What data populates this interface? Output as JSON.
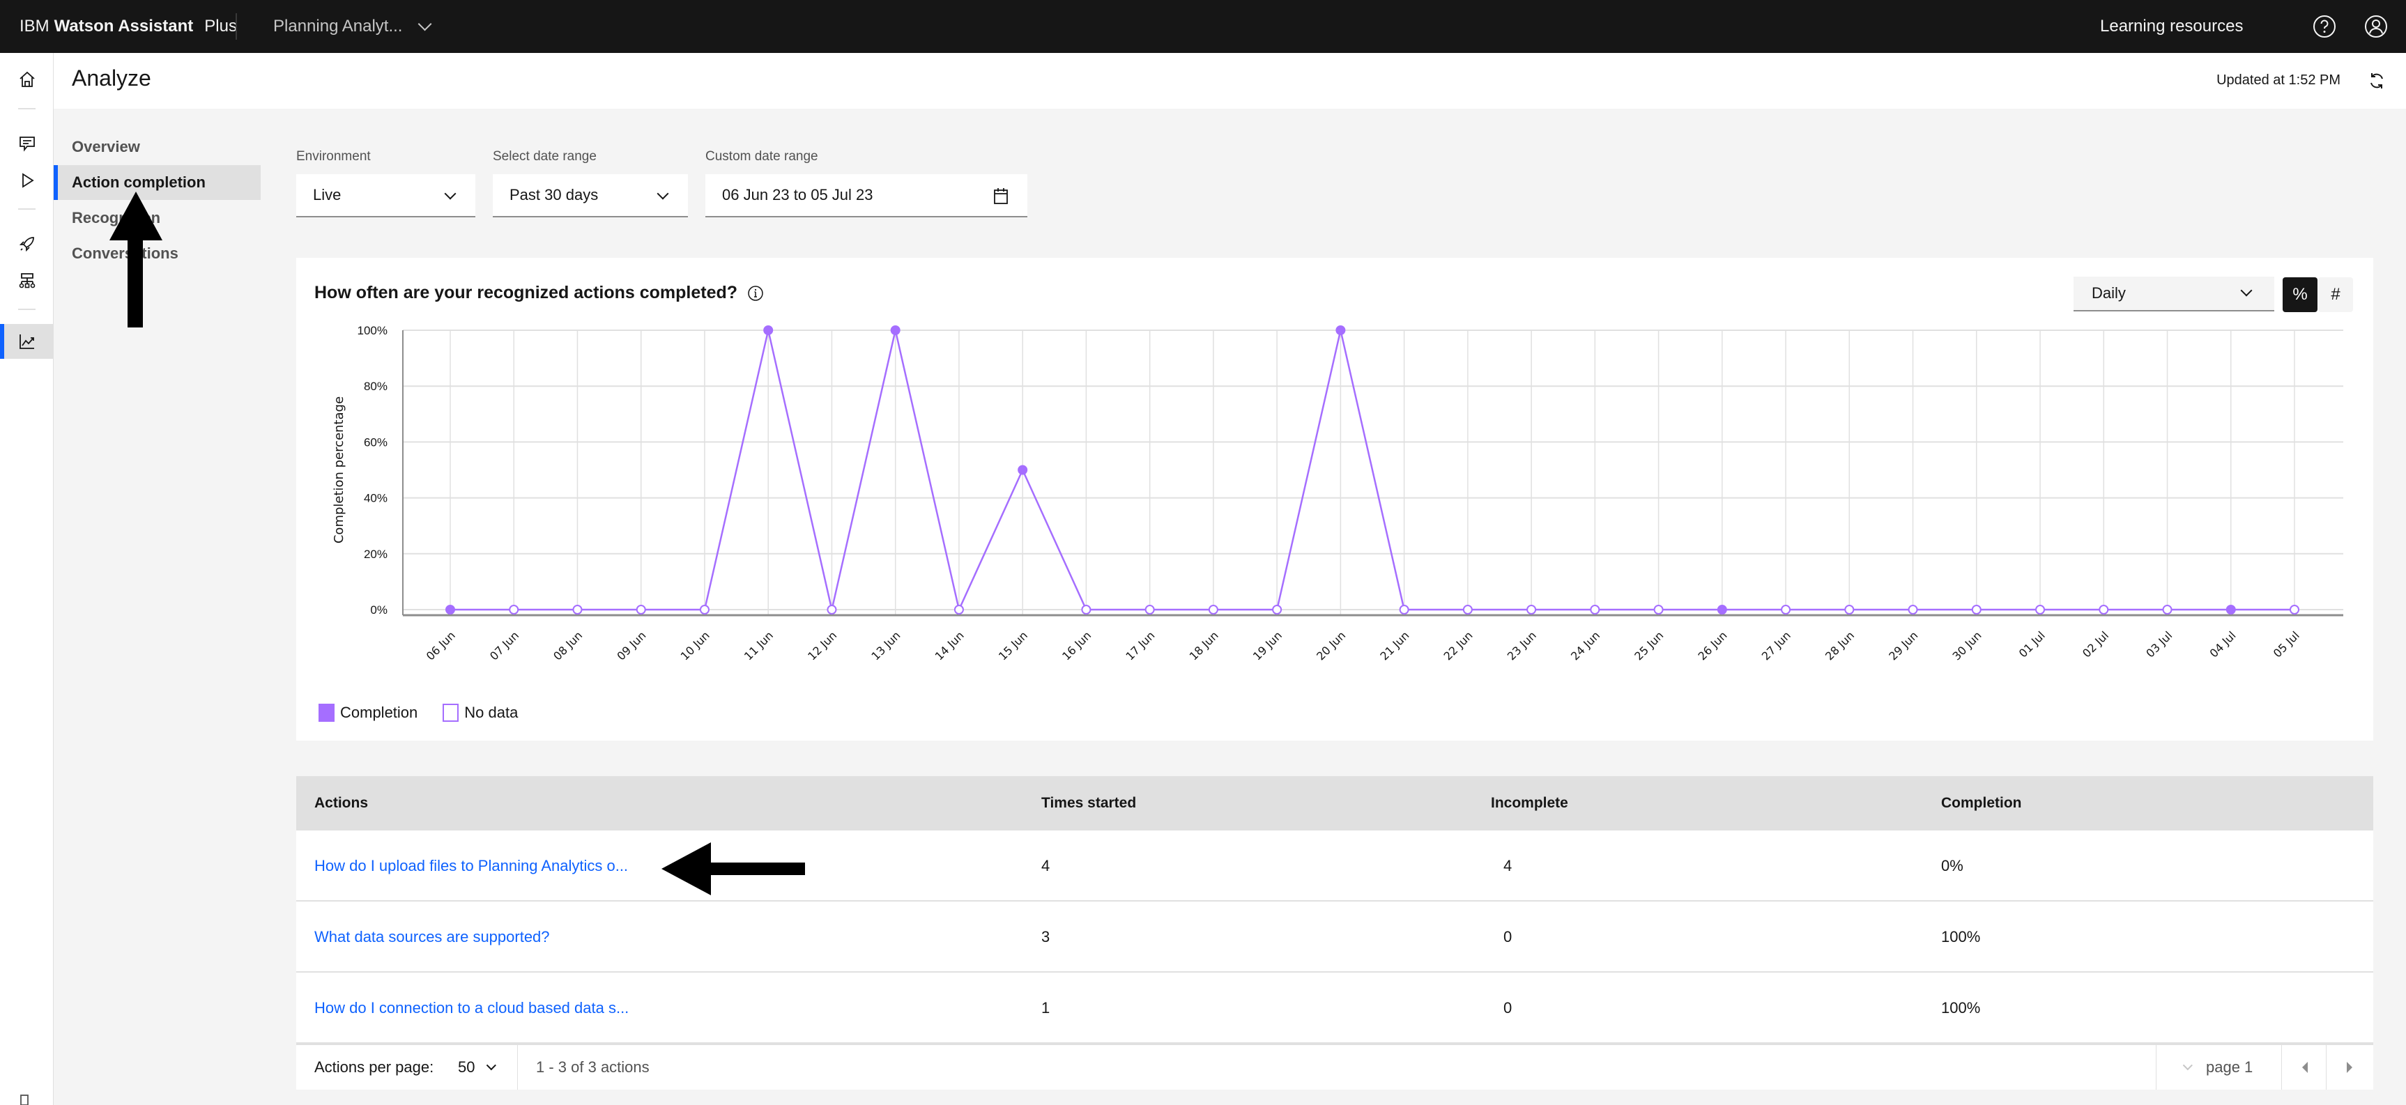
{
  "topbar": {
    "brand_prefix": "IBM",
    "brand_name": "Watson Assistant",
    "brand_plan": "Plus",
    "assistant_name": "Planning Analyt...",
    "learning_resources": "Learning resources",
    "icons": [
      "help-icon",
      "user-avatar-icon"
    ]
  },
  "rail": {
    "items": [
      {
        "name": "home",
        "icon": "home-icon"
      },
      {
        "name": "actions",
        "icon": "chat-icon"
      },
      {
        "name": "preview",
        "icon": "play-icon"
      },
      {
        "name": "publish",
        "icon": "rocket-icon"
      },
      {
        "name": "environments",
        "icon": "hierarchy-icon"
      },
      {
        "name": "analyze",
        "icon": "chart-line-icon",
        "active": true
      }
    ]
  },
  "header": {
    "title": "Analyze",
    "updated": "Updated at 1:52 PM"
  },
  "subnav": {
    "items": [
      {
        "label": "Overview",
        "active": false
      },
      {
        "label": "Action completion",
        "active": true
      },
      {
        "label": "Recognition",
        "active": false
      },
      {
        "label": "Conversations",
        "active": false
      }
    ]
  },
  "filters": {
    "environment_label": "Environment",
    "environment_value": "Live",
    "date_range_label": "Select date range",
    "date_range_value": "Past 30 days",
    "custom_range_label": "Custom date range",
    "custom_range_value": "06 Jun 23 to 05 Jul 23"
  },
  "chart_card": {
    "title": "How often are your recognized actions completed?",
    "granularity": "Daily",
    "toggle_percent": "%",
    "toggle_count": "#",
    "legend": [
      {
        "label": "Completion",
        "style": "filled"
      },
      {
        "label": "No data",
        "style": "hollow"
      }
    ]
  },
  "chart_data": {
    "type": "line",
    "title": "How often are your recognized actions completed?",
    "xlabel": "",
    "ylabel": "Completion percentage",
    "ylim": [
      0,
      100
    ],
    "yticks": [
      "0%",
      "20%",
      "40%",
      "60%",
      "80%",
      "100%"
    ],
    "ytick_values": [
      0,
      20,
      40,
      60,
      80,
      100
    ],
    "grid": true,
    "legend_position": "bottom-left",
    "color": "#a56eff",
    "x": [
      "06 Jun",
      "07 Jun",
      "08 Jun",
      "09 Jun",
      "10 Jun",
      "11 Jun",
      "12 Jun",
      "13 Jun",
      "14 Jun",
      "15 Jun",
      "16 Jun",
      "17 Jun",
      "18 Jun",
      "19 Jun",
      "20 Jun",
      "21 Jun",
      "22 Jun",
      "23 Jun",
      "24 Jun",
      "25 Jun",
      "26 Jun",
      "27 Jun",
      "28 Jun",
      "29 Jun",
      "30 Jun",
      "01 Jul",
      "02 Jul",
      "03 Jul",
      "04 Jul",
      "05 Jul"
    ],
    "series": [
      {
        "name": "Completion",
        "values": [
          0,
          0,
          0,
          0,
          0,
          100,
          0,
          100,
          0,
          50,
          0,
          0,
          0,
          0,
          100,
          0,
          0,
          0,
          0,
          0,
          0,
          0,
          0,
          0,
          0,
          0,
          0,
          0,
          0,
          0
        ],
        "has_data": [
          true,
          false,
          false,
          false,
          false,
          true,
          false,
          true,
          false,
          true,
          false,
          false,
          false,
          false,
          true,
          false,
          false,
          false,
          false,
          false,
          true,
          false,
          false,
          false,
          false,
          false,
          false,
          false,
          true,
          false
        ]
      }
    ]
  },
  "table": {
    "columns": [
      "Actions",
      "Times started",
      "Incomplete",
      "Completion"
    ],
    "rows": [
      {
        "action": "How do I upload files to Planning Analytics o...",
        "started": "4",
        "incomplete": "4",
        "completion": "0%"
      },
      {
        "action": "What data sources are supported?",
        "started": "3",
        "incomplete": "0",
        "completion": "100%"
      },
      {
        "action": "How do I connection to a cloud based data s...",
        "started": "1",
        "incomplete": "0",
        "completion": "100%"
      }
    ],
    "pagination": {
      "per_page_label": "Actions per page:",
      "per_page_value": "50",
      "range_text": "1 - 3 of 3 actions",
      "page_text": "page 1"
    }
  }
}
